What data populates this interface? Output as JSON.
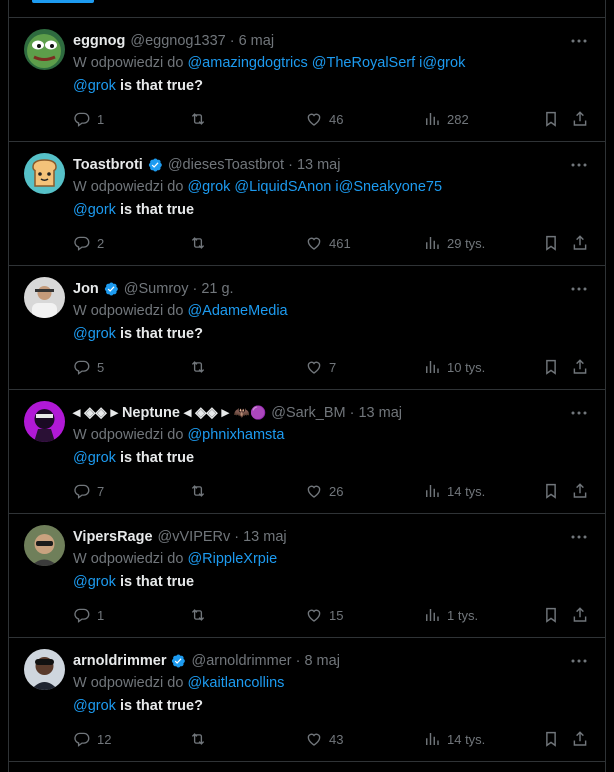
{
  "labels": {
    "reply_prefix": "W odpowiedzi do"
  },
  "colors": {
    "accent": "#1d9bf0",
    "muted": "#71767b",
    "text": "#e7e9ea",
    "border": "#2f3336"
  },
  "tweets": [
    {
      "name": "eggnog",
      "handle": "@eggnog1337",
      "date": "6 maj",
      "verified": false,
      "avatar": "pepe-frog",
      "reply_mentions": "@amazingdogtrics @TheRoyalSerf i@grok",
      "body_mention": "@grok",
      "body_text": " is that true?",
      "replies": "1",
      "retweets": "",
      "likes": "46",
      "views": "282"
    },
    {
      "name": "Toastbroti",
      "handle": "@diesesToastbrot",
      "date": "13 maj",
      "verified": true,
      "avatar": "toast",
      "reply_mentions": "@grok @LiquidSAnon i@Sneakyone75",
      "body_mention": "@gork",
      "body_text": " is that true",
      "replies": "2",
      "retweets": "",
      "likes": "461",
      "views": "29 tys."
    },
    {
      "name": "Jon",
      "handle": "@Sumroy",
      "date": "21 g.",
      "verified": true,
      "avatar": "person-white",
      "reply_mentions": "@AdameMedia",
      "body_mention": "@grok",
      "body_text": " is that true?",
      "replies": "5",
      "retweets": "",
      "likes": "7",
      "views": "10 tys."
    },
    {
      "name": "◂ ◈◈ ▸ Neptune ◂ ◈◈ ▸",
      "handle": "@Sark_BM",
      "date": "13 maj",
      "verified": false,
      "badges": "🦇🟣",
      "avatar": "purple-character",
      "reply_mentions": "@phnixhamsta",
      "body_mention": "@grok",
      "body_text": " is that true",
      "replies": "7",
      "retweets": "",
      "likes": "26",
      "views": "14 tys."
    },
    {
      "name": "VipersRage",
      "handle": "@vVIPERv",
      "date": "13 maj",
      "verified": false,
      "avatar": "person-sunglasses",
      "reply_mentions": "@RippleXrpie",
      "body_mention": "@grok",
      "body_text": " is that true",
      "replies": "1",
      "retweets": "",
      "likes": "15",
      "views": "1 tys."
    },
    {
      "name": "arnoldrimmer",
      "handle": "@arnoldrimmer",
      "date": "8 maj",
      "verified": true,
      "avatar": "person-dark",
      "reply_mentions": "@kaitlancollins",
      "body_mention": "@grok",
      "body_text": " is that true?",
      "replies": "12",
      "retweets": "",
      "likes": "43",
      "views": "14 tys."
    }
  ]
}
